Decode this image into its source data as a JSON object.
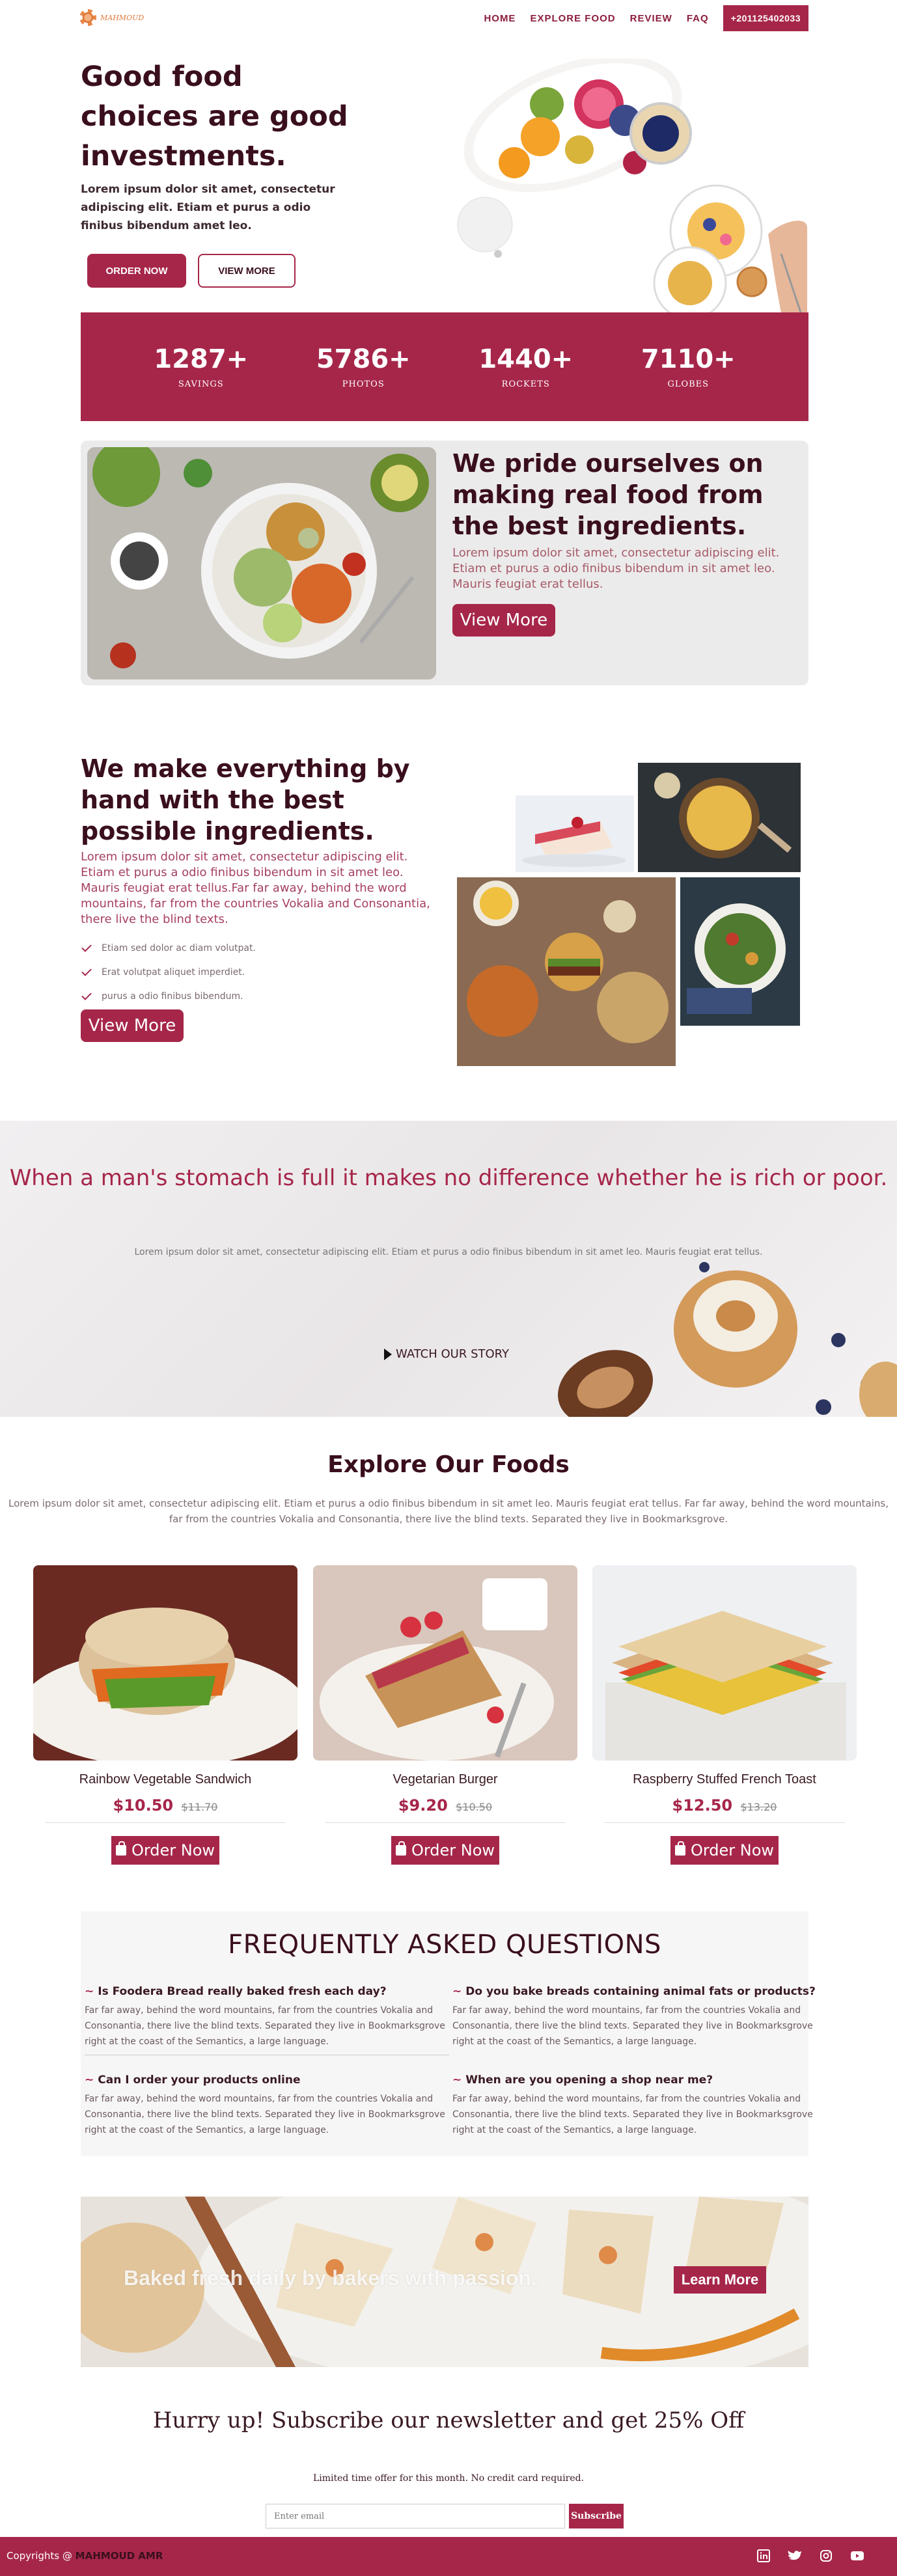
{
  "nav": {
    "logo_text": "MAHMOUD",
    "items": [
      "HOME",
      "EXPLORE FOOD",
      "REVIEW",
      "FAQ"
    ],
    "phone": "+201125402033"
  },
  "hero": {
    "title": "Good food choices are good investments.",
    "text": "Lorem ipsum dolor sit amet, consectetur adipiscing elit. Etiam et purus a odio finibus bibendum amet leo.",
    "order_btn": "ORDER NOW",
    "more_btn": "VIEW MORE"
  },
  "stats": [
    {
      "num": "1287+",
      "label": "SAVINGS"
    },
    {
      "num": "5786+",
      "label": "PHOTOS"
    },
    {
      "num": "1440+",
      "label": "ROCKETS"
    },
    {
      "num": "7110+",
      "label": "GLOBES"
    }
  ],
  "pride": {
    "title": "We pride ourselves on making real food from the best ingredients.",
    "text": "Lorem ipsum dolor sit amet, consectetur adipiscing elit. Etiam et purus a odio finibus bibendum in sit amet leo. Mauris feugiat erat tellus.",
    "button": "View More"
  },
  "handmade": {
    "title": "We make everything by hand with the best possible ingredients.",
    "text": "Lorem ipsum dolor sit amet, consectetur adipiscing elit. Etiam et purus a odio finibus bibendum in sit amet leo. Mauris feugiat erat tellus.Far far away, behind the word mountains, far from the countries Vokalia and Consonantia, there live the blind texts.",
    "checks": [
      "Etiam sed dolor ac diam volutpat.",
      "Erat volutpat aliquet imperdiet.",
      "purus a odio finibus bibendum."
    ],
    "button": "View More"
  },
  "quote": {
    "title": "When a man's stomach is full it makes no difference whether he is rich or poor.",
    "text": "Lorem ipsum dolor sit amet, consectetur adipiscing elit. Etiam et purus a odio finibus bibendum in sit amet leo. Mauris feugiat erat tellus.",
    "watch": "WATCH OUR STORY"
  },
  "explore": {
    "title": "Explore Our Foods",
    "text": "Lorem ipsum dolor sit amet, consectetur adipiscing elit. Etiam et purus a odio finibus bibendum in sit amet leo. Mauris feugiat erat tellus. Far far away, behind the word mountains, far from the countries Vokalia and Consonantia, there live the blind texts. Separated they live in Bookmarksgrove.",
    "cards": [
      {
        "name": "Rainbow Vegetable Sandwich",
        "price": "$10.50",
        "old_price": "$11.70",
        "button": "Order Now"
      },
      {
        "name": "Vegetarian Burger",
        "price": "$9.20",
        "old_price": "$10.50",
        "button": "Order Now"
      },
      {
        "name": "Raspberry Stuffed French Toast",
        "price": "$12.50",
        "old_price": "$13.20",
        "button": "Order Now"
      }
    ]
  },
  "faq": {
    "title": "FREQUENTLY ASKED QUESTIONS",
    "items": [
      {
        "q": "Is Foodera Bread really baked fresh each day?",
        "a": "Far far away, behind the word mountains, far from the countries Vokalia and Consonantia, there live the blind texts. Separated they live in Bookmarksgrove right at the coast of the Semantics, a large language."
      },
      {
        "q": "Do you bake breads containing animal fats or products?",
        "a": "Far far away, behind the word mountains, far from the countries Vokalia and Consonantia, there live the blind texts. Separated they live in Bookmarksgrove right at the coast of the Semantics, a large language."
      },
      {
        "q": "Can I order your products online",
        "a": "Far far away, behind the word mountains, far from the countries Vokalia and Consonantia, there live the blind texts. Separated they live in Bookmarksgrove right at the coast of the Semantics, a large language."
      },
      {
        "q": "When are you opening a shop near me?",
        "a": "Far far away, behind the word mountains, far from the countries Vokalia and Consonantia, there live the blind texts. Separated they live in Bookmarksgrove right at the coast of the Semantics, a large language."
      }
    ]
  },
  "promo": {
    "text": "Baked fresh daily by bakers with passion.",
    "button": "Learn More"
  },
  "newsletter": {
    "title": "Hurry up! Subscribe our newsletter and get 25% Off",
    "sub": "Limited time offer for this month. No credit card required.",
    "placeholder": "Enter email",
    "button": "Subscribe"
  },
  "footer": {
    "copy_prefix": "Copyrights @",
    "copy_name": "MAHMOUD AMR",
    "social": [
      "linkedin-icon",
      "twitter-icon",
      "instagram-icon",
      "youtube-icon"
    ]
  },
  "colors": {
    "brand": "#a6264a",
    "dark": "#3a0f1d"
  }
}
